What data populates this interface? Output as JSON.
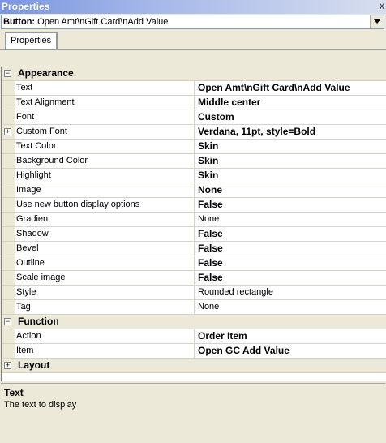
{
  "window": {
    "title": "Properties",
    "close_glyph": "x"
  },
  "selector": {
    "type_label": "Button:",
    "value": "Open Amt\\nGift Card\\nAdd Value"
  },
  "tabs": [
    "Properties"
  ],
  "grid": {
    "appearance": {
      "label": "Appearance",
      "rows": [
        {
          "name": "Text",
          "value": "Open Amt\\nGift Card\\nAdd Value",
          "bold": true
        },
        {
          "name": "Text Alignment",
          "value": "Middle center",
          "bold": true
        },
        {
          "name": "Font",
          "value": "Custom",
          "bold": true
        },
        {
          "name": "Custom Font",
          "value": "Verdana, 11pt, style=Bold",
          "bold": true,
          "expandable": true
        },
        {
          "name": "Text Color",
          "value": "Skin",
          "bold": true
        },
        {
          "name": "Background Color",
          "value": "Skin",
          "bold": true
        },
        {
          "name": "Highlight",
          "value": "Skin",
          "bold": true
        },
        {
          "name": "Image",
          "value": "None",
          "bold": true
        },
        {
          "name": "Use new button display options",
          "value": "False",
          "bold": true
        },
        {
          "name": "Gradient",
          "value": "None",
          "bold": false
        },
        {
          "name": "Shadow",
          "value": "False",
          "bold": true
        },
        {
          "name": "Bevel",
          "value": "False",
          "bold": true
        },
        {
          "name": "Outline",
          "value": "False",
          "bold": true
        },
        {
          "name": "Scale image",
          "value": "False",
          "bold": true
        },
        {
          "name": "Style",
          "value": "Rounded rectangle",
          "bold": false
        },
        {
          "name": "Tag",
          "value": "None",
          "bold": false
        }
      ]
    },
    "function": {
      "label": "Function",
      "rows": [
        {
          "name": "Action",
          "value": "Order Item",
          "bold": true
        },
        {
          "name": "Item",
          "value": "Open GC Add Value",
          "bold": true
        }
      ]
    },
    "layout": {
      "label": "Layout"
    }
  },
  "description": {
    "title": "Text",
    "body": "The text to display"
  }
}
